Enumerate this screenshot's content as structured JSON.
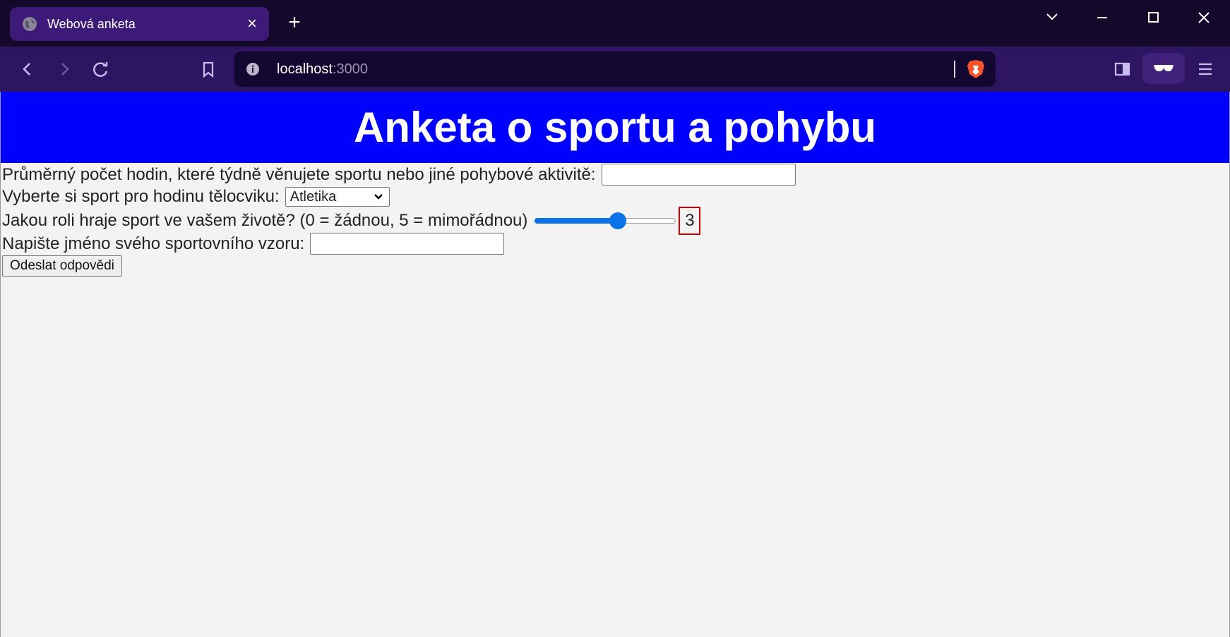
{
  "browser": {
    "tab_title": "Webová anketa",
    "tab_close": "×",
    "new_tab": "+",
    "url_host": "localhost",
    "url_port": ":3000",
    "accent": "#3d1a78"
  },
  "page": {
    "heading": "Anketa o sportu a pohybu",
    "banner_color": "#0000ff",
    "q1_label": "Průměrný počet hodin, které týdně věnujete sportu nebo jiné pohybové aktivitě:",
    "q1_value": "",
    "q2_label": "Vyberte si sport pro hodinu tělocviku:",
    "q2_selected": "Atletika",
    "q3_label": "Jakou roli hraje sport ve vašem životě? (0 = žádnou, 5 = mimořádnou)",
    "q3_min": 0,
    "q3_max": 5,
    "q3_value": 3,
    "q3_value_text": "3",
    "q4_label": "Napište jméno svého sportovního vzoru:",
    "q4_value": "",
    "submit_label": "Odeslat odpovědi"
  }
}
